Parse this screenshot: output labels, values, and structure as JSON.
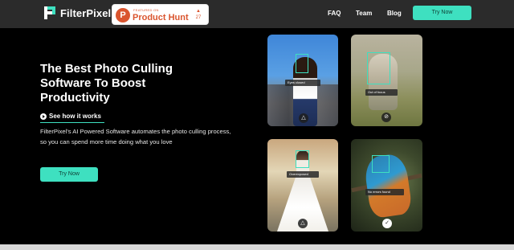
{
  "header": {
    "brand": "FilterPixel",
    "product_hunt": {
      "small": "FEATURED ON",
      "name": "Product Hunt",
      "votes": "27",
      "icon_letter": "P"
    },
    "nav": [
      "FAQ",
      "Team",
      "Blog"
    ],
    "cta": "Try Now"
  },
  "hero": {
    "title": "The Best Photo Culling Software To Boost Productivity",
    "link": "See how it works",
    "description": "FilterPixel's AI Powered Software automates the photo culling process, so you can spend more time doing what you love",
    "cta": "Try Now"
  },
  "cards": [
    {
      "tag": "Eyes closed",
      "status_icon": "warning-icon"
    },
    {
      "tag": "Out of focus",
      "status_icon": "reject-icon"
    },
    {
      "tag": "Overexposed",
      "status_icon": "warning-icon"
    },
    {
      "tag": "No errors found",
      "status_icon": "check-icon"
    }
  ],
  "colors": {
    "accent": "#3ee0c0",
    "header_bg": "#2b2b2b",
    "page_bg": "#000000",
    "product_hunt": "#da552f"
  }
}
